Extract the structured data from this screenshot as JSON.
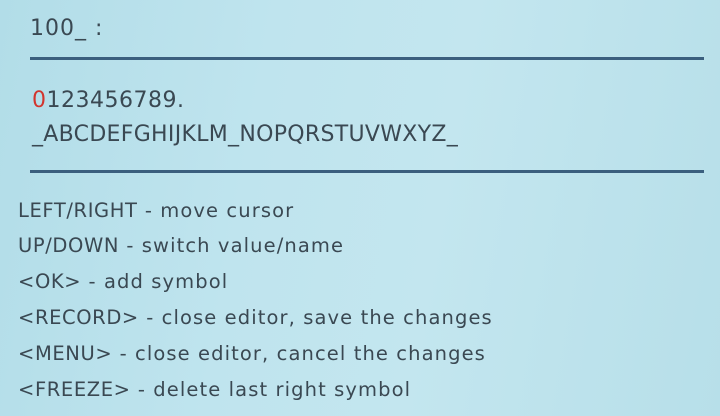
{
  "editor": {
    "input_value": "100_ :",
    "digits_cursor": "0",
    "digits_rest": "123456789.",
    "letters": "_ABCDEFGHIJKLM_NOPQRSTUVWXYZ_",
    "cursor_color": "#d2352e"
  },
  "help": [
    {
      "key": "LEFT/RIGHT",
      "text": " - move cursor"
    },
    {
      "key": "UP/DOWN",
      "text": " - switch value/name"
    },
    {
      "key": "<OK>",
      "text": " - add symbol"
    },
    {
      "key": "<RECORD>",
      "text": " - close editor, save the changes"
    },
    {
      "key": "<MENU>",
      "text": " - close editor, cancel the changes"
    },
    {
      "key": "<FREEZE>",
      "text": " - delete last right symbol"
    }
  ]
}
